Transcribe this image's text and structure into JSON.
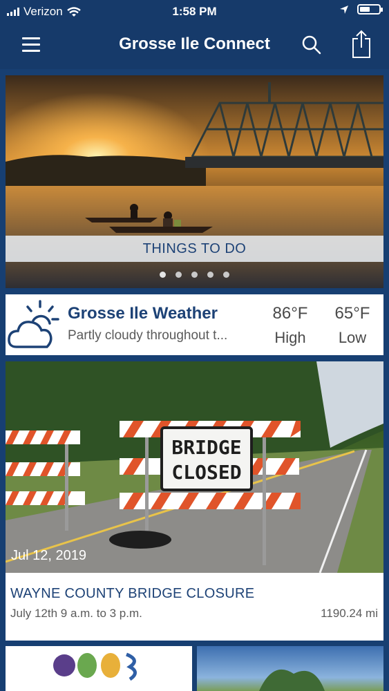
{
  "status_bar": {
    "carrier": "Verizon",
    "time": "1:58 PM",
    "battery_level": 0.55
  },
  "nav": {
    "title": "Grosse Ile Connect",
    "icons": [
      "menu-icon",
      "search-icon",
      "share-icon"
    ]
  },
  "hero": {
    "caption": "THINGS TO DO",
    "slide_count": 5,
    "active_slide": 0
  },
  "weather": {
    "title": "Grosse Ile Weather",
    "summary": "Partly cloudy throughout t...",
    "high_temp": "86°F",
    "high_label": "High",
    "low_temp": "65°F",
    "low_label": "Low"
  },
  "news_card": {
    "date": "Jul 12, 2019",
    "title": "WAYNE COUNTY BRIDGE CLOSURE",
    "subtitle": "July 12th 9 a.m. to 3 p.m.",
    "distance": "1190.24 mi",
    "sign_line1": "BRIDGE",
    "sign_line2": "CLOSED"
  },
  "colors": {
    "brand_navy": "#163a6a",
    "title_blue": "#1d4276"
  }
}
